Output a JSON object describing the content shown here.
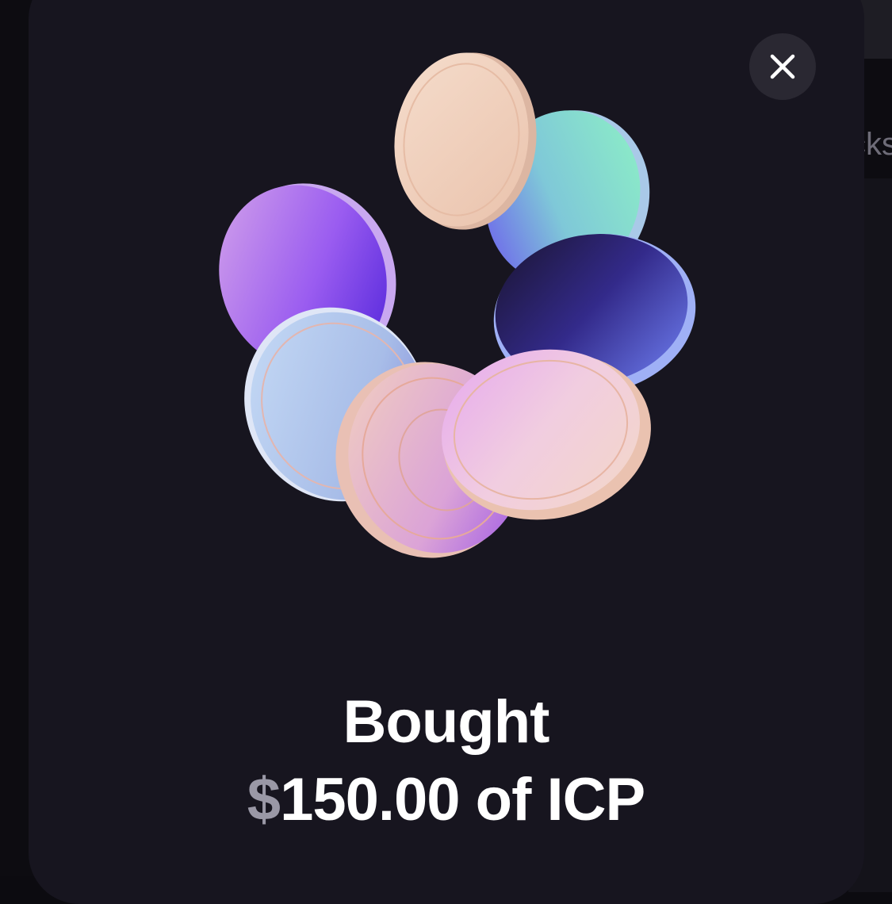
{
  "background": {
    "peek_text": "cks"
  },
  "modal": {
    "close_icon": "close-icon",
    "illustration_icon": "coins-illustration",
    "headline_line1": "Bought",
    "currency_symbol": "$",
    "amount_text": "150.00 of ICP"
  },
  "colors": {
    "modal_bg": "#17151f",
    "close_button_bg": "#2a2832",
    "text_primary": "#ffffff",
    "currency_symbol": "#9a98a6"
  }
}
